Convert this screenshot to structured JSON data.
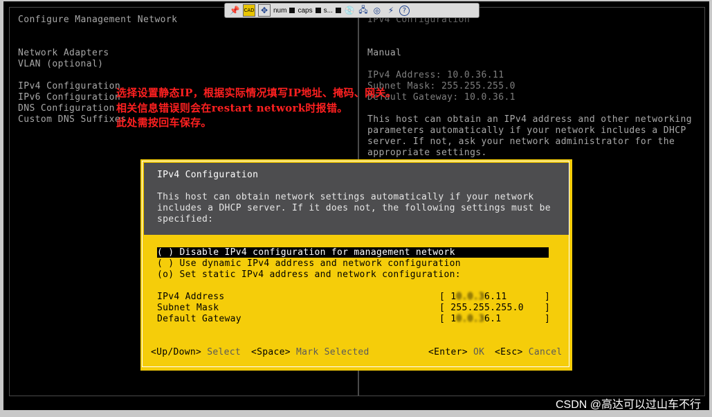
{
  "toolbar": {
    "items": [
      "num",
      "caps",
      "s..."
    ]
  },
  "background": {
    "title": "Configure Management Network",
    "menu": [
      "Network Adapters",
      "VLAN (optional)",
      "",
      "IPv4 Configuration",
      "IPv6 Configuration",
      "DNS Configuration",
      "Custom DNS Suffixes"
    ],
    "right_title": "IPv4 Configuration",
    "right_mode": "Manual",
    "right_ip": "IPv4 Address: 10.0.36.11",
    "right_mask": "Subnet Mask: 255.255.255.0",
    "right_gw": "Default Gateway: 10.0.36.1",
    "right_desc": [
      "This host can obtain an IPv4 address and other networking",
      "parameters automatically if your network includes a DHCP",
      "server. If not, ask your network administrator for the",
      "appropriate settings."
    ]
  },
  "annotation": {
    "lines": [
      "选择设置静态IP，根据实际情况填写IP地址、掩码、网关。",
      "相关信息错误则会在restart network时报错。",
      "此处需按回车保存。"
    ]
  },
  "dialog": {
    "title": "IPv4 Configuration",
    "desc": [
      "This host can obtain network settings automatically if your network",
      "includes a DHCP server. If it does not, the following settings must be",
      "specified:"
    ],
    "options": [
      "( ) Disable IPv4 configuration for management network",
      "( ) Use dynamic IPv4 address and network configuration",
      "(o) Set static IPv4 address and network configuration:"
    ],
    "fields": [
      {
        "label": "IPv4 Address",
        "value": "1",
        "hidden": "0.0.3",
        "tail": "6.11"
      },
      {
        "label": "Subnet Mask",
        "value": "255.255.255.0",
        "hidden": "",
        "tail": ""
      },
      {
        "label": "Default Gateway",
        "value": "1",
        "hidden": "0.0.3",
        "tail": "6.1"
      }
    ],
    "hints": {
      "updown_key": "<Up/Down>",
      "updown_lbl": "Select",
      "space_key": "<Space>",
      "space_lbl": "Mark Selected",
      "enter_key": "<Enter>",
      "enter_lbl": "OK",
      "esc_key": "<Esc>",
      "esc_lbl": "Cancel"
    }
  },
  "watermark": "CSDN @高达可以过山车不行"
}
